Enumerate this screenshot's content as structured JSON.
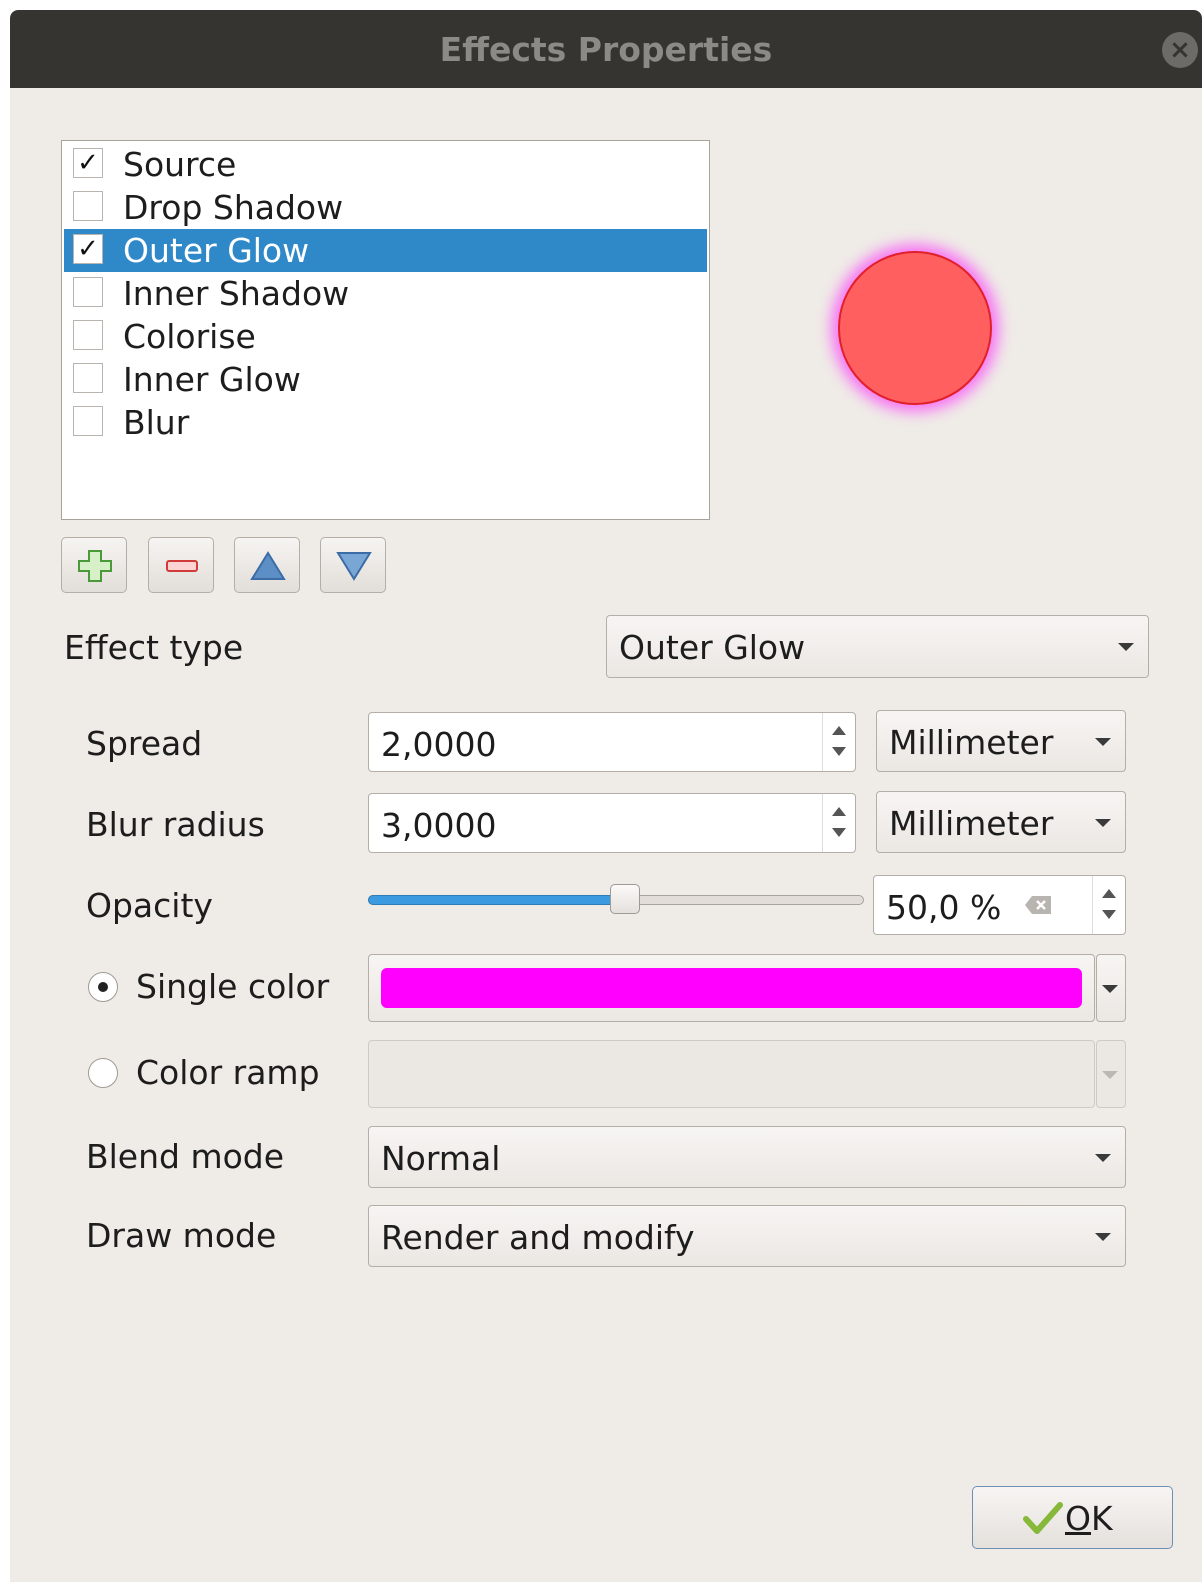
{
  "window": {
    "title": "Effects Properties"
  },
  "effects_list": {
    "items": [
      {
        "label": "Source",
        "checked": true,
        "selected": false
      },
      {
        "label": "Drop Shadow",
        "checked": false,
        "selected": false
      },
      {
        "label": "Outer Glow",
        "checked": true,
        "selected": true
      },
      {
        "label": "Inner Shadow",
        "checked": false,
        "selected": false
      },
      {
        "label": "Colorise",
        "checked": false,
        "selected": false
      },
      {
        "label": "Inner Glow",
        "checked": false,
        "selected": false
      },
      {
        "label": "Blur",
        "checked": false,
        "selected": false
      }
    ],
    "check_glyph": "✓"
  },
  "toolbar": {
    "add_icon": "add-plus-icon",
    "remove_icon": "remove-minus-icon",
    "up_icon": "arrow-up-icon",
    "down_icon": "arrow-down-icon"
  },
  "effect_type": {
    "label": "Effect type",
    "value": "Outer Glow"
  },
  "spread": {
    "label": "Spread",
    "value": "2,0000",
    "unit": "Millimeter"
  },
  "blur_radius": {
    "label": "Blur radius",
    "value": "3,0000",
    "unit": "Millimeter"
  },
  "opacity": {
    "label": "Opacity",
    "value": "50,0 %",
    "level": 0.5,
    "clear_icon": "clear-backspace-icon"
  },
  "single_color": {
    "label": "Single color",
    "selected": true,
    "color": "#ff00ff"
  },
  "color_ramp": {
    "label": "Color ramp",
    "selected": false
  },
  "blend_mode": {
    "label": "Blend mode",
    "value": "Normal"
  },
  "draw_mode": {
    "label": "Draw mode",
    "value": "Render and modify"
  },
  "ok_button": {
    "label": "OK",
    "mnemonic": "O",
    "rest": "K"
  },
  "colors": {
    "selection": "#2f89c8",
    "preview_fill": "#ff5f5f",
    "preview_stroke": "#e0202b",
    "glow": "#ff00ff",
    "slider_fill": "#3c9be0"
  }
}
